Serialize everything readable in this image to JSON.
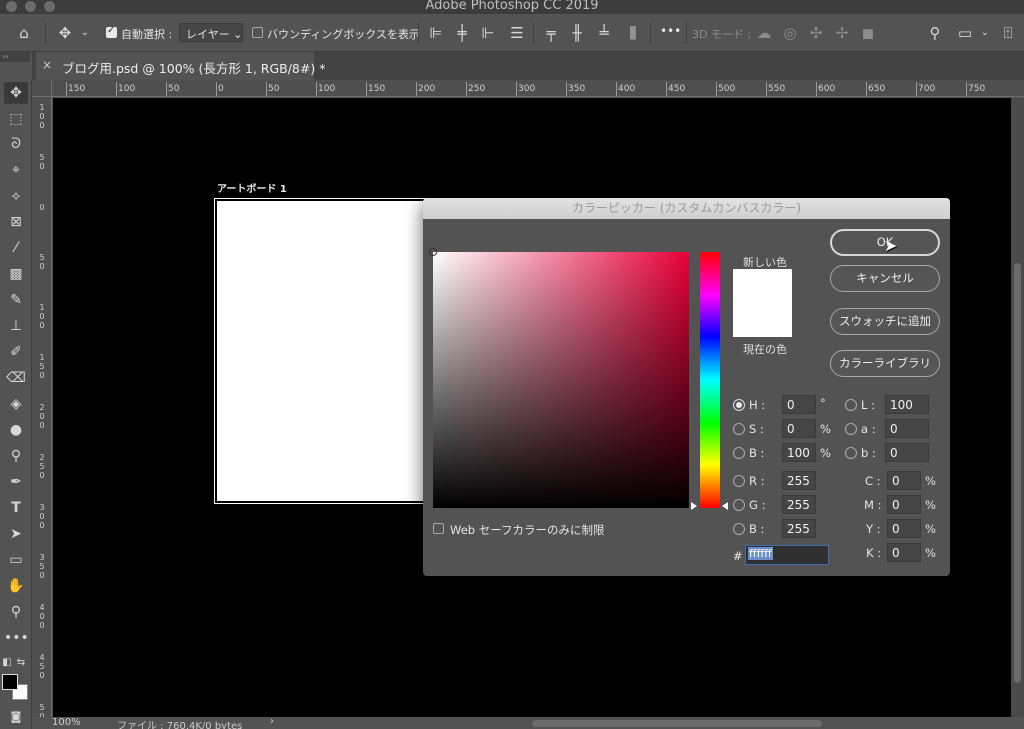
{
  "window": {
    "title": "Adobe Photoshop CC 2019"
  },
  "options_bar": {
    "auto_select_label": "自動選択 :",
    "auto_select_value": "レイヤー",
    "bounding_box_label": "バウンディングボックスを表示",
    "mode_3d_label": "3D モード :",
    "more_label": "•••"
  },
  "document": {
    "tab_title": "ブログ用.psd @ 100% (長方形 1, RGB/8#) *",
    "artboard_label": "アートボード 1",
    "zoom": "100%",
    "file_info": "ファイル : 760.4K/0 bytes"
  },
  "ruler": {
    "top_ticks": [
      "150",
      "100",
      "50",
      "0",
      "50",
      "100",
      "150",
      "200",
      "250",
      "300",
      "350",
      "400",
      "450",
      "500",
      "550",
      "600",
      "650",
      "700",
      "750"
    ],
    "left_ticks": [
      "100",
      "50",
      "0",
      "50",
      "100",
      "150",
      "200",
      "250",
      "300",
      "350",
      "400",
      "450",
      "500"
    ]
  },
  "color_picker": {
    "title": "カラーピッカー (カスタムカンバスカラー)",
    "new_label": "新しい色",
    "current_label": "現在の色",
    "buttons": {
      "ok": "OK",
      "cancel": "キャンセル",
      "add_swatch": "スウォッチに追加",
      "color_library": "カラーライブラリ"
    },
    "web_only_label": "Web セーフカラーのみに制限",
    "hsb": {
      "h_label": "H :",
      "h": "0",
      "h_unit": "°",
      "s_label": "S :",
      "s": "0",
      "s_unit": "%",
      "b_label": "B :",
      "b": "100",
      "b_unit": "%"
    },
    "lab": {
      "l_label": "L :",
      "l": "100",
      "a_label": "a :",
      "a": "0",
      "b_label": "b :",
      "b": "0"
    },
    "rgb": {
      "r_label": "R :",
      "r": "255",
      "g_label": "G :",
      "g": "255",
      "b_label": "B :",
      "b": "255"
    },
    "cmyk": {
      "c_label": "C :",
      "c": "0",
      "m_label": "M :",
      "m": "0",
      "y_label": "Y :",
      "y": "0",
      "k_label": "K :",
      "k": "0",
      "unit": "%"
    },
    "hex_label": "#",
    "hex": "ffffff",
    "selected_mode": "H",
    "hue_color": "#e8003a"
  }
}
